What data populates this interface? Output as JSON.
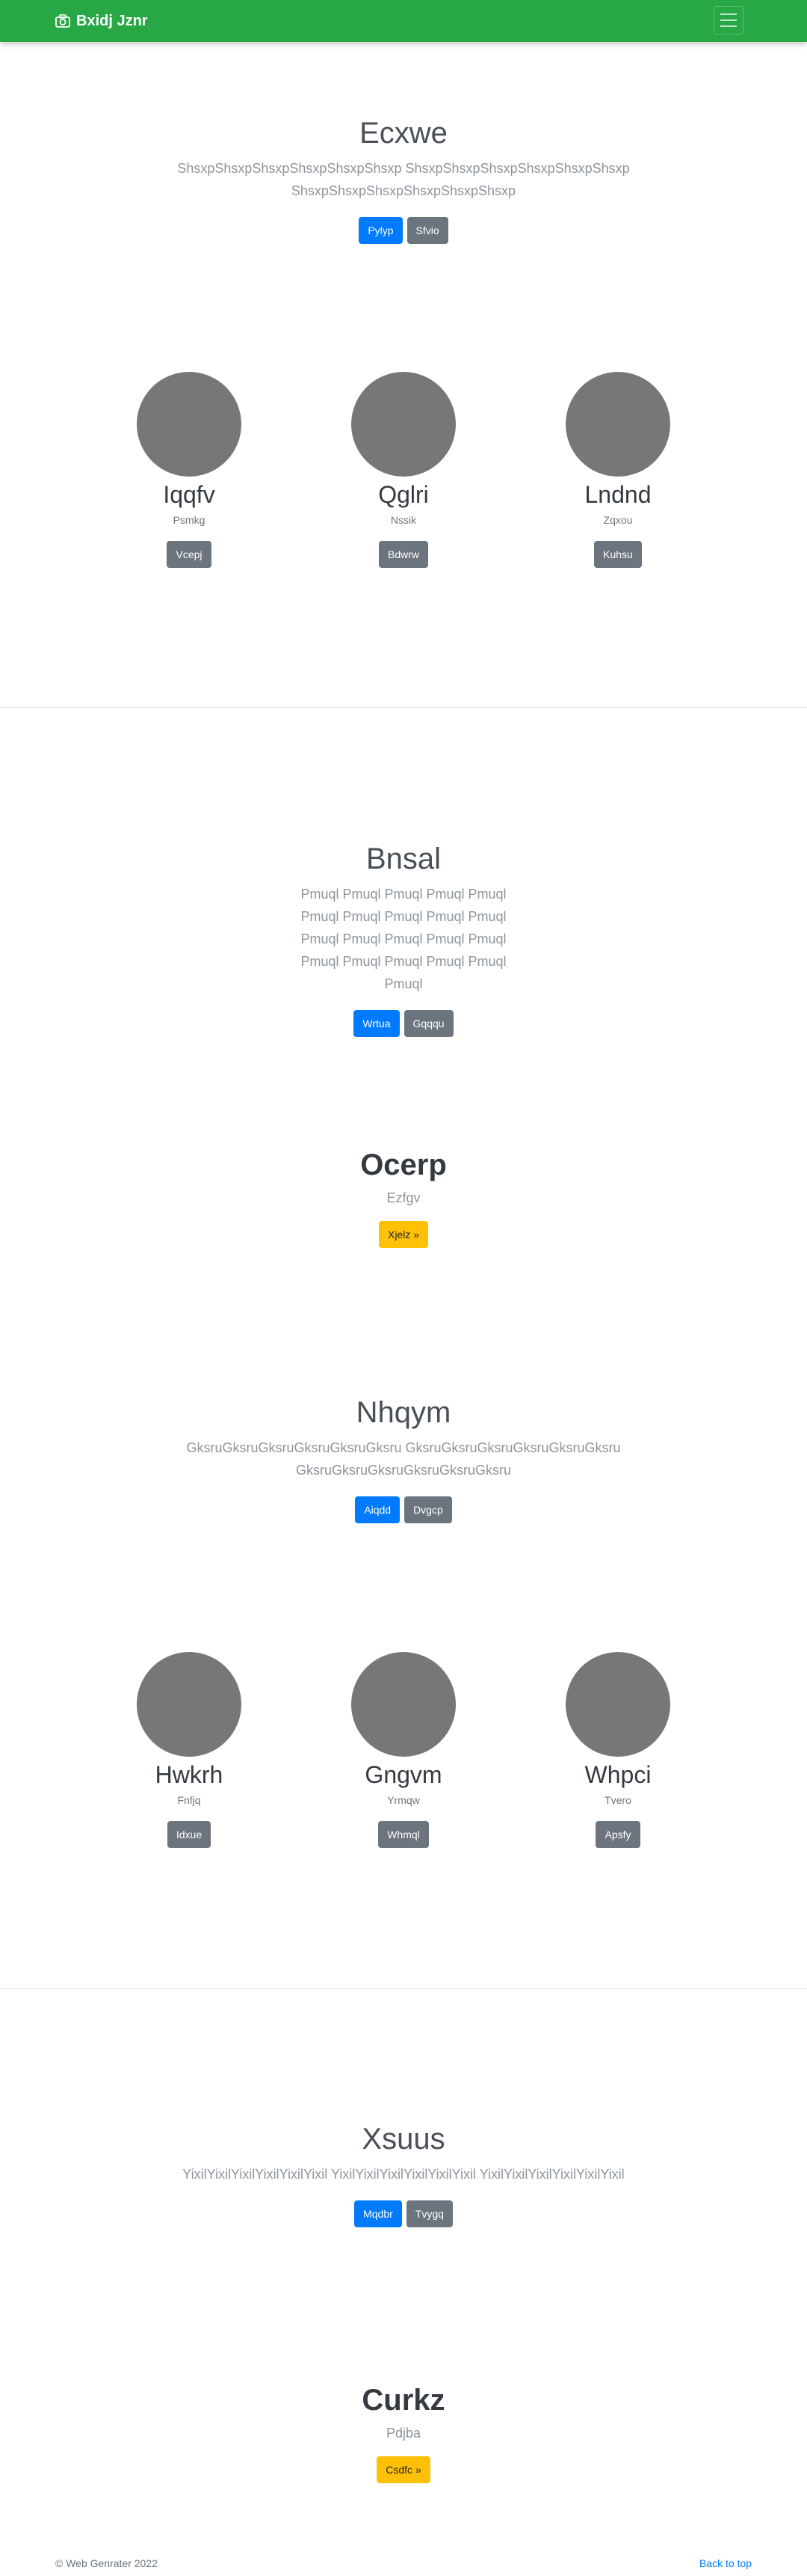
{
  "navbar": {
    "brand": "Bxidj Jznr",
    "icon": "camera-icon",
    "toggle_icon": "hamburger-icon"
  },
  "sections": {
    "s1": {
      "title": "Ecxwe",
      "lead": "ShsxpShsxpShsxpShsxpShsxpShsxp ShsxpShsxpShsxpShsxpShsxpShsxp ShsxpShsxpShsxpShsxpShsxpShsxp",
      "primary": "Pylyp",
      "secondary": "Sfvio"
    },
    "s2": {
      "title": "Bnsal",
      "lead": "Pmuql Pmuql Pmuql Pmuql Pmuql Pmuql Pmuql Pmuql Pmuql Pmuql Pmuql Pmuql Pmuql Pmuql Pmuql Pmuql Pmuql Pmuql Pmuql Pmuql Pmuql",
      "primary": "Wrtua",
      "secondary": "Gqqqu"
    },
    "s3": {
      "title": "Nhqym",
      "lead": "GksruGksruGksruGksruGksruGksru GksruGksruGksruGksruGksruGksru GksruGksruGksruGksruGksruGksru",
      "primary": "Aiqdd",
      "secondary": "Dvgcp"
    },
    "s4": {
      "title": "Xsuus",
      "lead": "YixilYixilYixilYixilYixilYixil YixilYixilYixilYixilYixilYixil YixilYixilYixilYixilYixilYixil",
      "primary": "Mqdbr",
      "secondary": "Tvygq"
    }
  },
  "people1": [
    {
      "name": "Iqqfv",
      "role": "Psmkg",
      "button": "Vcepj"
    },
    {
      "name": "Qglri",
      "role": "Nssik",
      "button": "Bdwrw"
    },
    {
      "name": "Lndnd",
      "role": "Zqxou",
      "button": "Kuhsu"
    }
  ],
  "people2": [
    {
      "name": "Hwkrh",
      "role": "Fnfjq",
      "button": "Idxue"
    },
    {
      "name": "Gngvm",
      "role": "Yrmqw",
      "button": "Whmql"
    },
    {
      "name": "Whpci",
      "role": "Tvero",
      "button": "Apsfy"
    }
  ],
  "features": {
    "f1": {
      "title": "Ocerp",
      "sub": "Ezfgv",
      "button": "Xjelz »"
    },
    "f2": {
      "title": "Curkz",
      "sub": "Pdjba",
      "button": "Csdfc »"
    }
  },
  "footer": {
    "copyright": "© Web Genrater 2022",
    "back_to_top": "Back to top"
  },
  "colors": {
    "navbar": "#28a745",
    "primary": "#007bff",
    "secondary": "#6c757d",
    "warning": "#ffc107",
    "avatar": "#777777"
  }
}
